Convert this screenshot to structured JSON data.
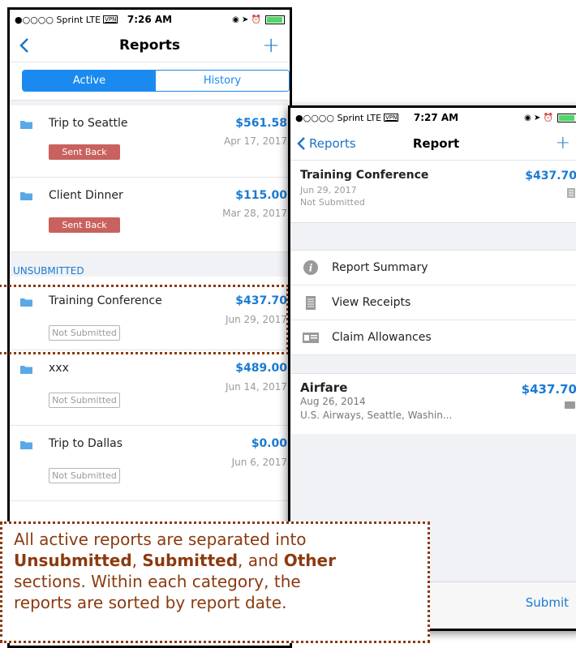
{
  "phone1": {
    "status": {
      "carrier": "●○○○○ Sprint  LTE",
      "vpn": "VPN",
      "time": "7:26 AM"
    },
    "nav": {
      "title": "Reports",
      "plus": "+"
    },
    "tabs": [
      "Active",
      "History"
    ],
    "reports_sent_back": [
      {
        "name": "Trip to Seattle",
        "amount": "$561.58",
        "date": "Apr 17, 2017",
        "status": "Sent Back"
      },
      {
        "name": "Client Dinner",
        "amount": "$115.00",
        "date": "Mar 28, 2017",
        "status": "Sent Back"
      }
    ],
    "section_unsubmitted": "UNSUBMITTED",
    "reports_unsubmitted": [
      {
        "name": "Training Conference",
        "amount": "$437.70",
        "date": "Jun 29, 2017",
        "status": "Not Submitted"
      },
      {
        "name": "xxx",
        "amount": "$489.00",
        "date": "Jun 14, 2017",
        "status": "Not Submitted"
      },
      {
        "name": "Trip to Dallas",
        "amount": "$0.00",
        "date": "Jun 6, 2017",
        "status": "Not Submitted"
      }
    ]
  },
  "phone2": {
    "status": {
      "carrier": "●○○○○ Sprint  LTE",
      "vpn": "VPN",
      "time": "7:27 AM"
    },
    "nav": {
      "back": "Reports",
      "title": "Report",
      "plus": "+"
    },
    "header": {
      "title": "Training Conference",
      "date": "Jun 29, 2017",
      "status": "Not Submitted",
      "amount": "$437.70"
    },
    "menu": [
      "Report Summary",
      "View Receipts",
      "Claim Allowances"
    ],
    "expense": {
      "title": "Airfare",
      "date": "Aug 26, 2014",
      "detail": "U.S. Airways, Seattle, Washin...",
      "amount": "$437.70"
    },
    "footer": {
      "submit": "Submit"
    }
  },
  "callout": {
    "line1": "All active reports are separated into",
    "b1": "Unsubmitted",
    "sep1": ", ",
    "b2": "Submitted",
    "sep2": ", and ",
    "b3": "Other",
    "line3": "sections. Within each category, the",
    "line4": "reports are sorted by report date."
  },
  "colors": {
    "accent": "#1a8af0",
    "link": "#1a7ad4",
    "sent_back": "#c9625f",
    "callout": "#8b3a0f"
  }
}
